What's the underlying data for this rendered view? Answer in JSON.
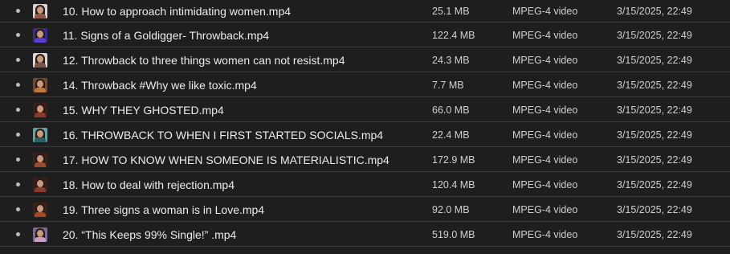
{
  "files": [
    {
      "name": "10. How to approach intimidating women.mp4",
      "size": "25.1 MB",
      "type": "MPEG-4 video",
      "date": "3/15/2025, 22:49",
      "thumb_bg": "#d9d4d2",
      "thumb_body": "#8e5a4a"
    },
    {
      "name": "11. Signs of a Goldigger- Throwback.mp4",
      "size": "122.4 MB",
      "type": "MPEG-4 video",
      "date": "3/15/2025, 22:49",
      "thumb_bg": "#3b2a8f",
      "thumb_body": "#5a3fd0"
    },
    {
      "name": "12. Throwback to three things women can not resist.mp4",
      "size": "24.3 MB",
      "type": "MPEG-4 video",
      "date": "3/15/2025, 22:49",
      "thumb_bg": "#dcd6d4",
      "thumb_body": "#7a5448"
    },
    {
      "name": "14. Throwback #Why we like toxic.mp4",
      "size": "7.7 MB",
      "type": "MPEG-4 video",
      "date": "3/15/2025, 22:49",
      "thumb_bg": "#6e4a2e",
      "thumb_body": "#c07a3a"
    },
    {
      "name": "15. WHY THEY GHOSTED.mp4",
      "size": "66.0 MB",
      "type": "MPEG-4 video",
      "date": "3/15/2025, 22:49",
      "thumb_bg": "#3a1e1a",
      "thumb_body": "#8a3a2a"
    },
    {
      "name": "16. THROWBACK TO WHEN I FIRST STARTED SOCIALS.mp4",
      "size": "22.4 MB",
      "type": "MPEG-4 video",
      "date": "3/15/2025, 22:49",
      "thumb_bg": "#5fa3a8",
      "thumb_body": "#2c5f66"
    },
    {
      "name": "17. HOW TO KNOW WHEN SOMEONE IS MATERIALISTIC.mp4",
      "size": "172.9 MB",
      "type": "MPEG-4 video",
      "date": "3/15/2025, 22:49",
      "thumb_bg": "#3a201a",
      "thumb_body": "#9a4a30"
    },
    {
      "name": "18. How to deal with rejection.mp4",
      "size": "120.4 MB",
      "type": "MPEG-4 video",
      "date": "3/15/2025, 22:49",
      "thumb_bg": "#3a1e1c",
      "thumb_body": "#8a3a2e"
    },
    {
      "name": "19. Three signs a woman is in Love.mp4",
      "size": "92.0 MB",
      "type": "MPEG-4 video",
      "date": "3/15/2025, 22:49",
      "thumb_bg": "#3c2218",
      "thumb_body": "#a04a2a"
    },
    {
      "name": "20. “This Keeps 99% Single!” .mp4",
      "size": "519.0 MB",
      "type": "MPEG-4 video",
      "date": "3/15/2025, 22:49",
      "thumb_bg": "#7a6a9a",
      "thumb_body": "#c9a0c0"
    }
  ]
}
